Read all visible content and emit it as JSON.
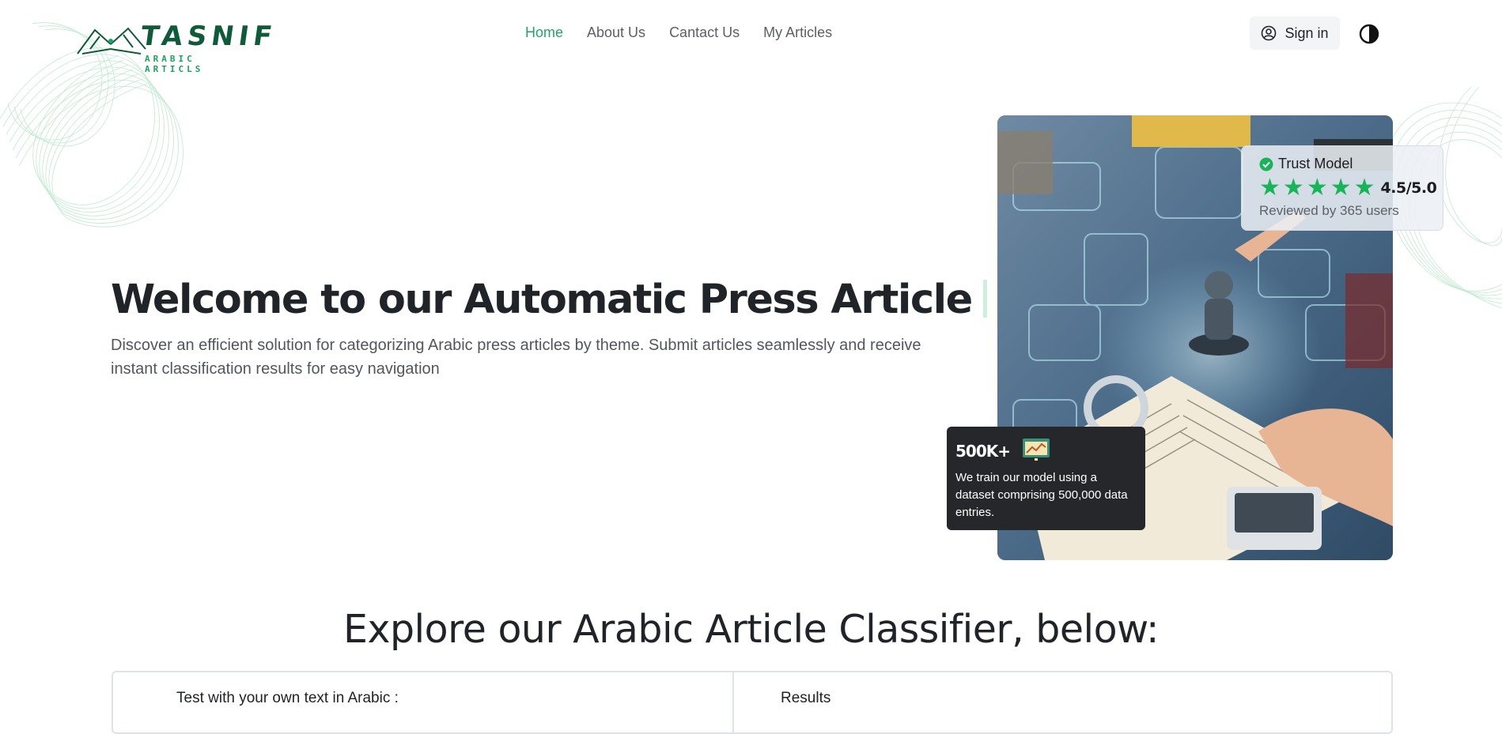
{
  "header": {
    "logo": {
      "word": "TASNIF",
      "sub": "ARABIC ARTICLS"
    },
    "nav": [
      {
        "label": "Home",
        "active": true
      },
      {
        "label": "About Us",
        "active": false
      },
      {
        "label": "Cantact Us",
        "active": false
      },
      {
        "label": "My Articles",
        "active": false
      }
    ],
    "signin_label": "Sign in",
    "icons": {
      "signin": "user-circle-icon",
      "theme": "half-circle-contrast-icon"
    }
  },
  "hero": {
    "title": "Welcome to our Automatic Press Article",
    "subtitle": "Discover an efficient solution for categorizing Arabic press articles by theme. Submit articles seamlessly and receive instant classification results for easy navigation"
  },
  "trust_card": {
    "title": "Trust Model",
    "rating": "4.5/5.0",
    "stars": 5,
    "reviewed": "Reviewed by 365 users"
  },
  "stat_card": {
    "value": "500K+",
    "text": "We train our model using a dataset comprising 500,000 data entries."
  },
  "classifier": {
    "heading": "Explore our Arabic Article Classifier, below:",
    "input_label": "Test with your own text in Arabic :",
    "results_label": "Results"
  },
  "colors": {
    "accent_green": "#22a565",
    "star_green": "#19b45a",
    "dark_card": "#25272b",
    "logo_green": "#0f5a3a"
  }
}
